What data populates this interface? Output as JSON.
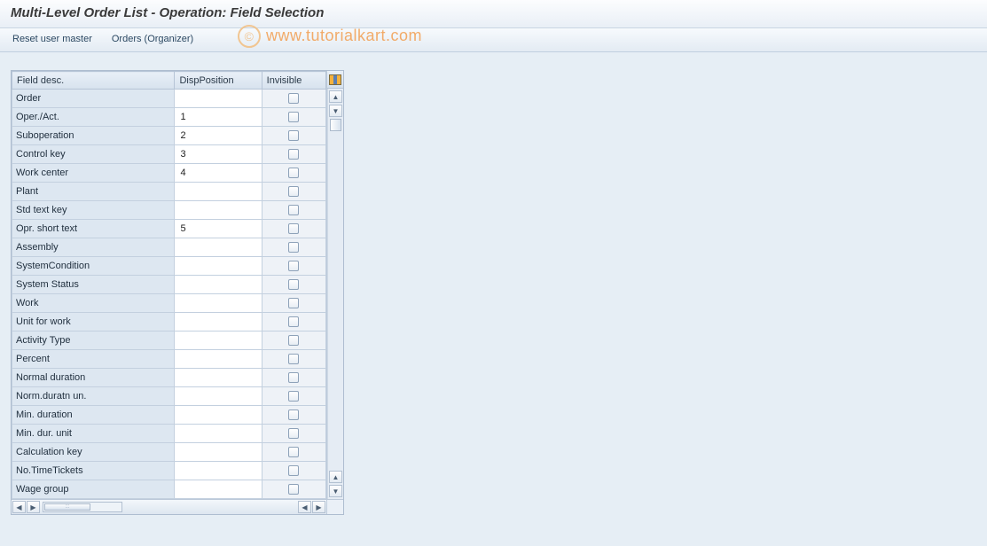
{
  "title": "Multi-Level Order List - Operation: Field Selection",
  "toolbar": {
    "reset_user_master": "Reset user master",
    "orders_organizer": "Orders (Organizer)"
  },
  "columns": {
    "field_desc": "Field desc.",
    "disp_position": "DispPosition",
    "invisible": "Invisible"
  },
  "rows": [
    {
      "desc": "Order",
      "pos": "",
      "inv": false
    },
    {
      "desc": "Oper./Act.",
      "pos": "1",
      "inv": false
    },
    {
      "desc": "Suboperation",
      "pos": "2",
      "inv": false
    },
    {
      "desc": "Control key",
      "pos": "3",
      "inv": false
    },
    {
      "desc": "Work center",
      "pos": "4",
      "inv": false
    },
    {
      "desc": "Plant",
      "pos": "",
      "inv": false
    },
    {
      "desc": "Std text key",
      "pos": "",
      "inv": false
    },
    {
      "desc": "Opr. short text",
      "pos": "5",
      "inv": false
    },
    {
      "desc": "Assembly",
      "pos": "",
      "inv": false
    },
    {
      "desc": "SystemCondition",
      "pos": "",
      "inv": false
    },
    {
      "desc": "System Status",
      "pos": "",
      "inv": false
    },
    {
      "desc": "Work",
      "pos": "",
      "inv": false
    },
    {
      "desc": "Unit for work",
      "pos": "",
      "inv": false
    },
    {
      "desc": "Activity Type",
      "pos": "",
      "inv": false
    },
    {
      "desc": "Percent",
      "pos": "",
      "inv": false
    },
    {
      "desc": "Normal duration",
      "pos": "",
      "inv": false
    },
    {
      "desc": "Norm.duratn un.",
      "pos": "",
      "inv": false
    },
    {
      "desc": "Min. duration",
      "pos": "",
      "inv": false
    },
    {
      "desc": "Min. dur. unit",
      "pos": "",
      "inv": false
    },
    {
      "desc": "Calculation key",
      "pos": "",
      "inv": false
    },
    {
      "desc": "No.TimeTickets",
      "pos": "",
      "inv": false
    },
    {
      "desc": "Wage group",
      "pos": "",
      "inv": false
    }
  ],
  "watermark": "www.tutorialkart.com",
  "col_widths": {
    "desc": 142,
    "pos": 76,
    "inv": 56
  }
}
